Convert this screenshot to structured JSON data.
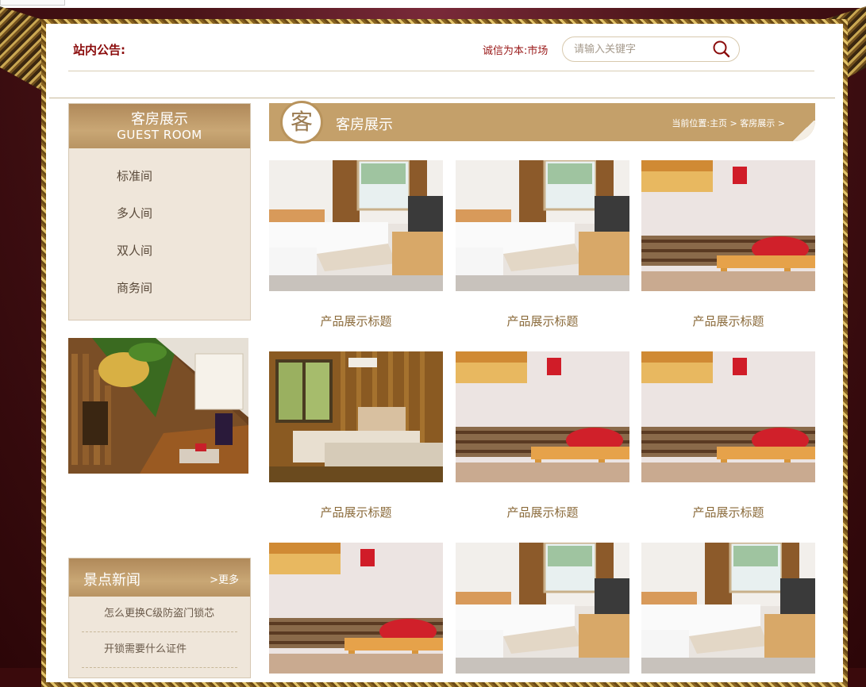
{
  "header": {
    "notice_label": "站内公告:",
    "marquee_text": "诚信为本:市场",
    "search_placeholder": "请输入关键字"
  },
  "sidebar": {
    "category_title_zh": "客房展示",
    "category_title_en": "GUEST ROOM",
    "categories": [
      {
        "label": "标准间"
      },
      {
        "label": "多人间"
      },
      {
        "label": "双人间"
      },
      {
        "label": "商务间"
      }
    ],
    "news_title": "景点新闻",
    "news_more": ">更多",
    "news": [
      {
        "title": "怎么更换C级防盗门锁芯"
      },
      {
        "title": "开锁需要什么证件"
      }
    ]
  },
  "main": {
    "circle_char": "客",
    "title": "客房展示",
    "breadcrumb": {
      "prefix": "当前位置:",
      "home": "主页",
      "sep1": " > ",
      "current": "客房展示",
      "sep2": " >"
    },
    "products": [
      {
        "title": "产品展示标题",
        "image": "standard-room-photo"
      },
      {
        "title": "产品展示标题",
        "image": "standard-room-photo"
      },
      {
        "title": "产品展示标题",
        "image": "red-room-photo"
      },
      {
        "title": "产品展示标题",
        "image": "wood-room-photo"
      },
      {
        "title": "产品展示标题",
        "image": "red-room-photo"
      },
      {
        "title": "产品展示标题",
        "image": "red-room-photo"
      },
      {
        "title": "",
        "image": "red-room-photo"
      },
      {
        "title": "",
        "image": "standard-room-photo"
      },
      {
        "title": "",
        "image": "standard-room-photo"
      }
    ]
  },
  "colors": {
    "accent_gold": "#c4a06a",
    "notice_red": "#8b0c0c",
    "panel_beige": "#efe6da"
  }
}
